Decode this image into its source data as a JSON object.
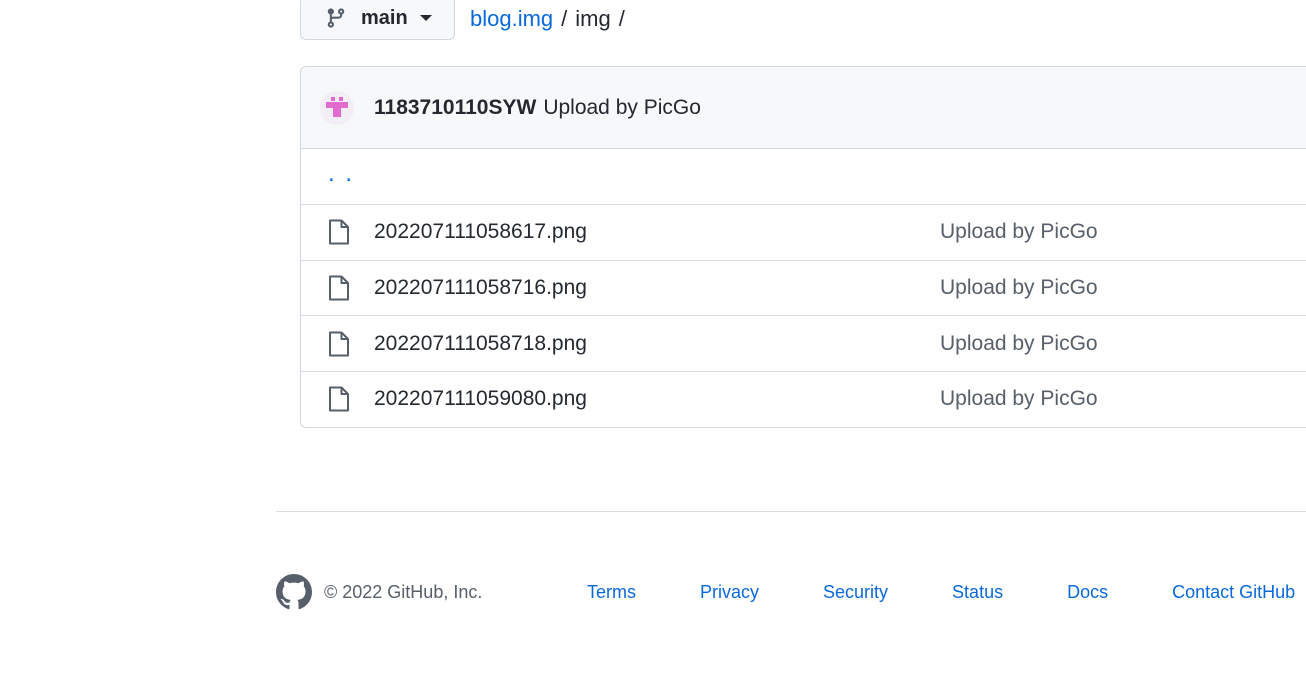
{
  "branch": {
    "name": "main",
    "icon": "git-branch-icon",
    "caret": "triangle-down-icon"
  },
  "breadcrumb": {
    "repo": "blog.img",
    "separator": "/",
    "folder": "img",
    "trailing": "/"
  },
  "commit": {
    "author": "1183710110SYW",
    "message": "Upload by PicGo",
    "avatar": "identicon-avatar"
  },
  "parent_dir": {
    "label": ". ."
  },
  "files": [
    {
      "name": "202207111058617.png",
      "commit": "Upload by PicGo",
      "icon": "file-icon"
    },
    {
      "name": "202207111058716.png",
      "commit": "Upload by PicGo",
      "icon": "file-icon"
    },
    {
      "name": "202207111058718.png",
      "commit": "Upload by PicGo",
      "icon": "file-icon"
    },
    {
      "name": "202207111059080.png",
      "commit": "Upload by PicGo",
      "icon": "file-icon"
    }
  ],
  "footer": {
    "copyright": "© 2022 GitHub, Inc.",
    "links": [
      "Terms",
      "Privacy",
      "Security",
      "Status",
      "Docs",
      "Contact GitHub"
    ]
  },
  "colors": {
    "link": "#0969da",
    "text": "#24292f",
    "muted": "#57606a",
    "border": "#d0d7de",
    "header_bg": "#f6f8fa",
    "avatar": "#e26bce"
  }
}
